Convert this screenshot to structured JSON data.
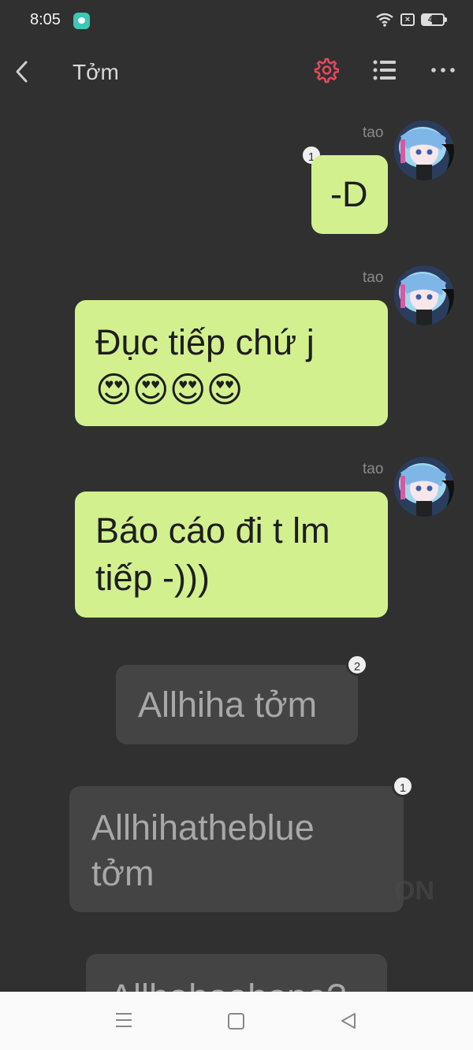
{
  "status_bar": {
    "time": "8:05",
    "battery": "45",
    "battery_level": 0.45,
    "sim_label": "×"
  },
  "header": {
    "title": "Tởm",
    "accent_color": "#e5485c"
  },
  "messages": [
    {
      "side": "me",
      "sender": "tao",
      "text": "-D",
      "badge": "1"
    },
    {
      "side": "me",
      "sender": "tao",
      "text": "Đục tiếp chứ j",
      "emoji": "😍😍😍😍"
    },
    {
      "side": "me",
      "sender": "tao",
      "line1": "Báo cáo đi t lm",
      "line2": "tiếp -)))"
    },
    {
      "side": "other",
      "text": "Allhiha tởm",
      "badge": "2"
    },
    {
      "side": "other",
      "line1": "Allhihatheblue",
      "line2": "tởm",
      "badge": "1"
    },
    {
      "side": "other",
      "text": "Allhahaahope?"
    }
  ],
  "watermark": "ON",
  "colors": {
    "background": "#303030",
    "my_bubble": "#d3f08f",
    "other_bubble": "#444444",
    "nav_bar": "#fafafa"
  }
}
